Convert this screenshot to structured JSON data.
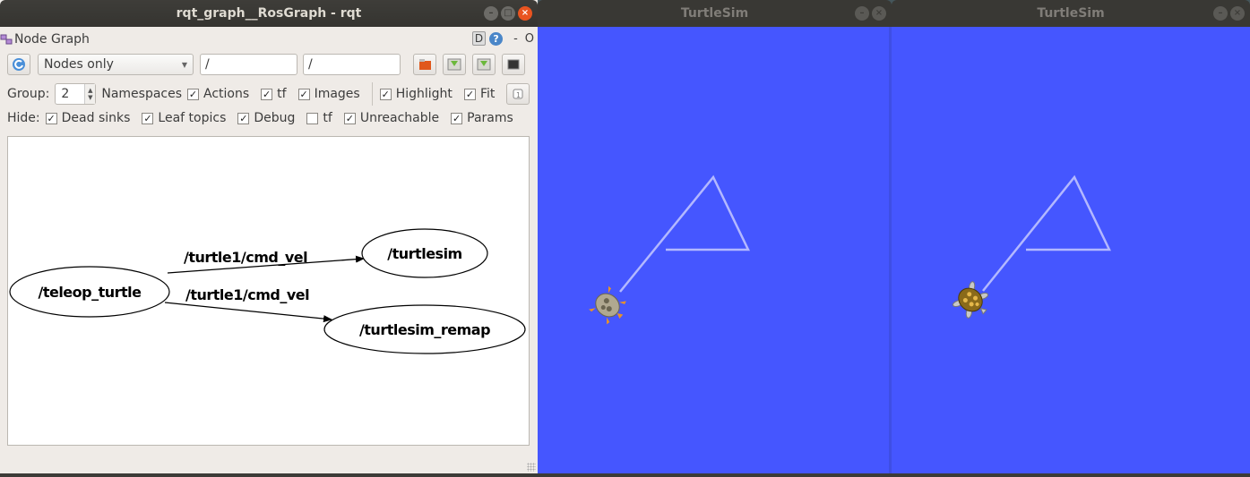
{
  "rqt_window": {
    "title": "rqt_graph__RosGraph - rqt",
    "dock_title": "Node Graph",
    "dock_controls": {
      "d_label": "D",
      "help_label": "?",
      "minimize_label": "-",
      "close_label": "O"
    },
    "toolbar": {
      "refresh_icon": "refresh-icon",
      "graph_type": "Nodes only",
      "node_filter": "/",
      "topic_filter": "/",
      "buttons": [
        "load-dot-icon",
        "save-dot-icon",
        "save-svg-icon",
        "save-image-icon"
      ]
    },
    "options_row": {
      "group_label": "Group:",
      "group_value": "2",
      "namespaces_label": "Namespaces",
      "checkboxes": [
        {
          "label": "Actions",
          "checked": true
        },
        {
          "label": "tf",
          "checked": true
        },
        {
          "label": "Images",
          "checked": true
        },
        {
          "label": "Highlight",
          "checked": true
        },
        {
          "label": "Fit",
          "checked": true
        }
      ]
    },
    "hide_row": {
      "hide_label": "Hide:",
      "checkboxes": [
        {
          "label": "Dead sinks",
          "checked": true
        },
        {
          "label": "Leaf topics",
          "checked": true
        },
        {
          "label": "Debug",
          "checked": true
        },
        {
          "label": "tf",
          "checked": false
        },
        {
          "label": "Unreachable",
          "checked": true
        },
        {
          "label": "Params",
          "checked": true
        }
      ]
    },
    "graph": {
      "nodes": [
        "/teleop_turtle",
        "/turtlesim",
        "/turtlesim_remap"
      ],
      "edges": [
        {
          "from": "/teleop_turtle",
          "to": "/turtlesim",
          "label": "/turtle1/cmd_vel"
        },
        {
          "from": "/teleop_turtle",
          "to": "/turtlesim_remap",
          "label": "/turtle1/cmd_vel"
        }
      ]
    }
  },
  "turtlesim_windows": [
    {
      "title": "TurtleSim",
      "background": "#4556ff",
      "pen_color": "#b3b8ff"
    },
    {
      "title": "TurtleSim",
      "background": "#4556ff",
      "pen_color": "#b3b8ff"
    }
  ],
  "check_mark": "✓"
}
